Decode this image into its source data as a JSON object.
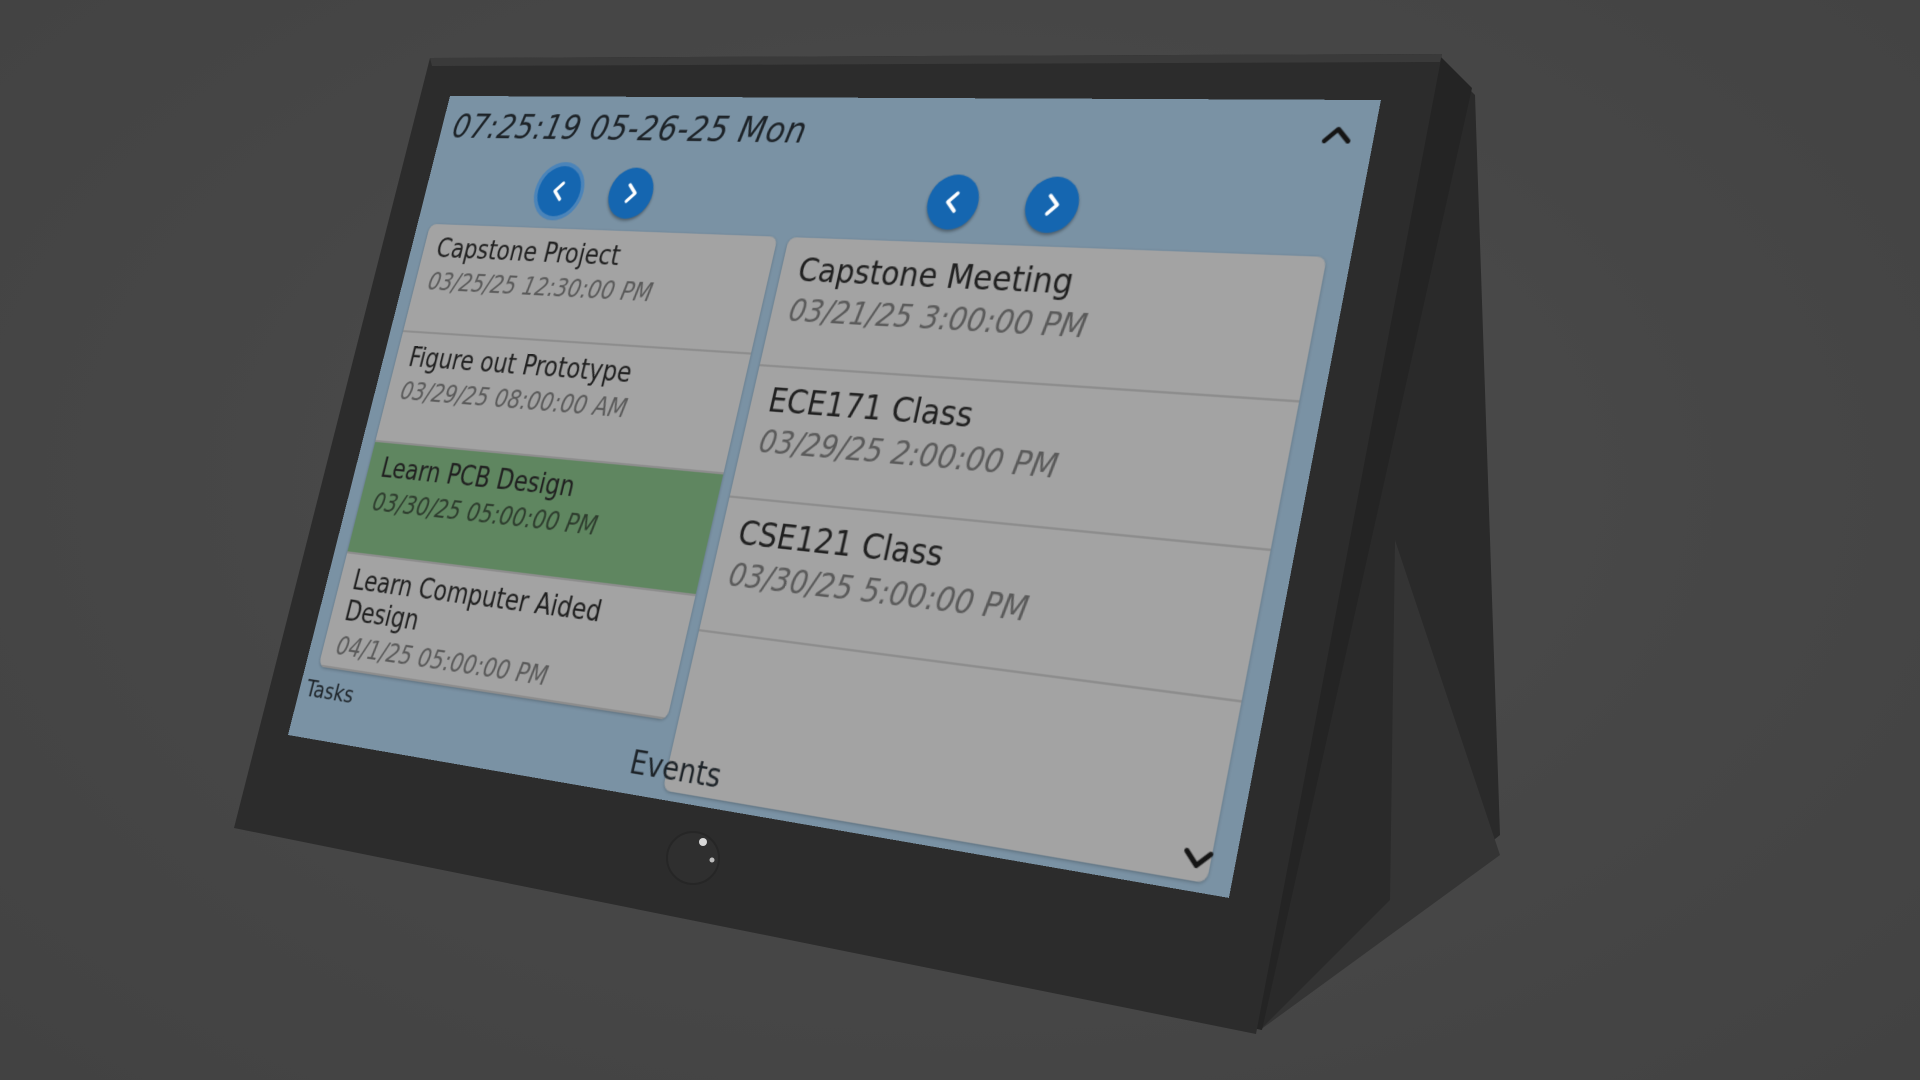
{
  "header": {
    "clock": "07:25:19 05-26-25 Mon",
    "collapse_icon": "chevron-up-icon",
    "expand_icon": "chevron-down-icon"
  },
  "tasks": {
    "label": "Tasks",
    "prev_icon": "chevron-left-icon",
    "next_icon": "chevron-right-icon",
    "items": [
      {
        "title": "Capstone Project",
        "date": "03/25/25 12:30:00 PM"
      },
      {
        "title": "Figure out Prototype",
        "date": "03/29/25 08:00:00 AM"
      },
      {
        "title": "Learn PCB Design",
        "date": "03/30/25 05:00:00 PM"
      },
      {
        "title": "Learn Computer Aided Design",
        "date": "04/1/25 05:00:00 PM"
      }
    ]
  },
  "events": {
    "label": "Events",
    "prev_icon": "chevron-left-icon",
    "next_icon": "chevron-right-icon",
    "items": [
      {
        "title": "Capstone Meeting",
        "date": "03/21/25 3:00:00 PM"
      },
      {
        "title": "ECE171 Class",
        "date": "03/29/25 2:00:00 PM"
      },
      {
        "title": "CSE121 Class",
        "date": "03/30/25 5:00:00 PM"
      }
    ]
  },
  "colors": {
    "screen_background": "#7a92a4",
    "nav_button": "#1566b0",
    "selected_item": "#5f8660",
    "panel": "#a3a3a3",
    "bezel": "#2b2b2b"
  }
}
